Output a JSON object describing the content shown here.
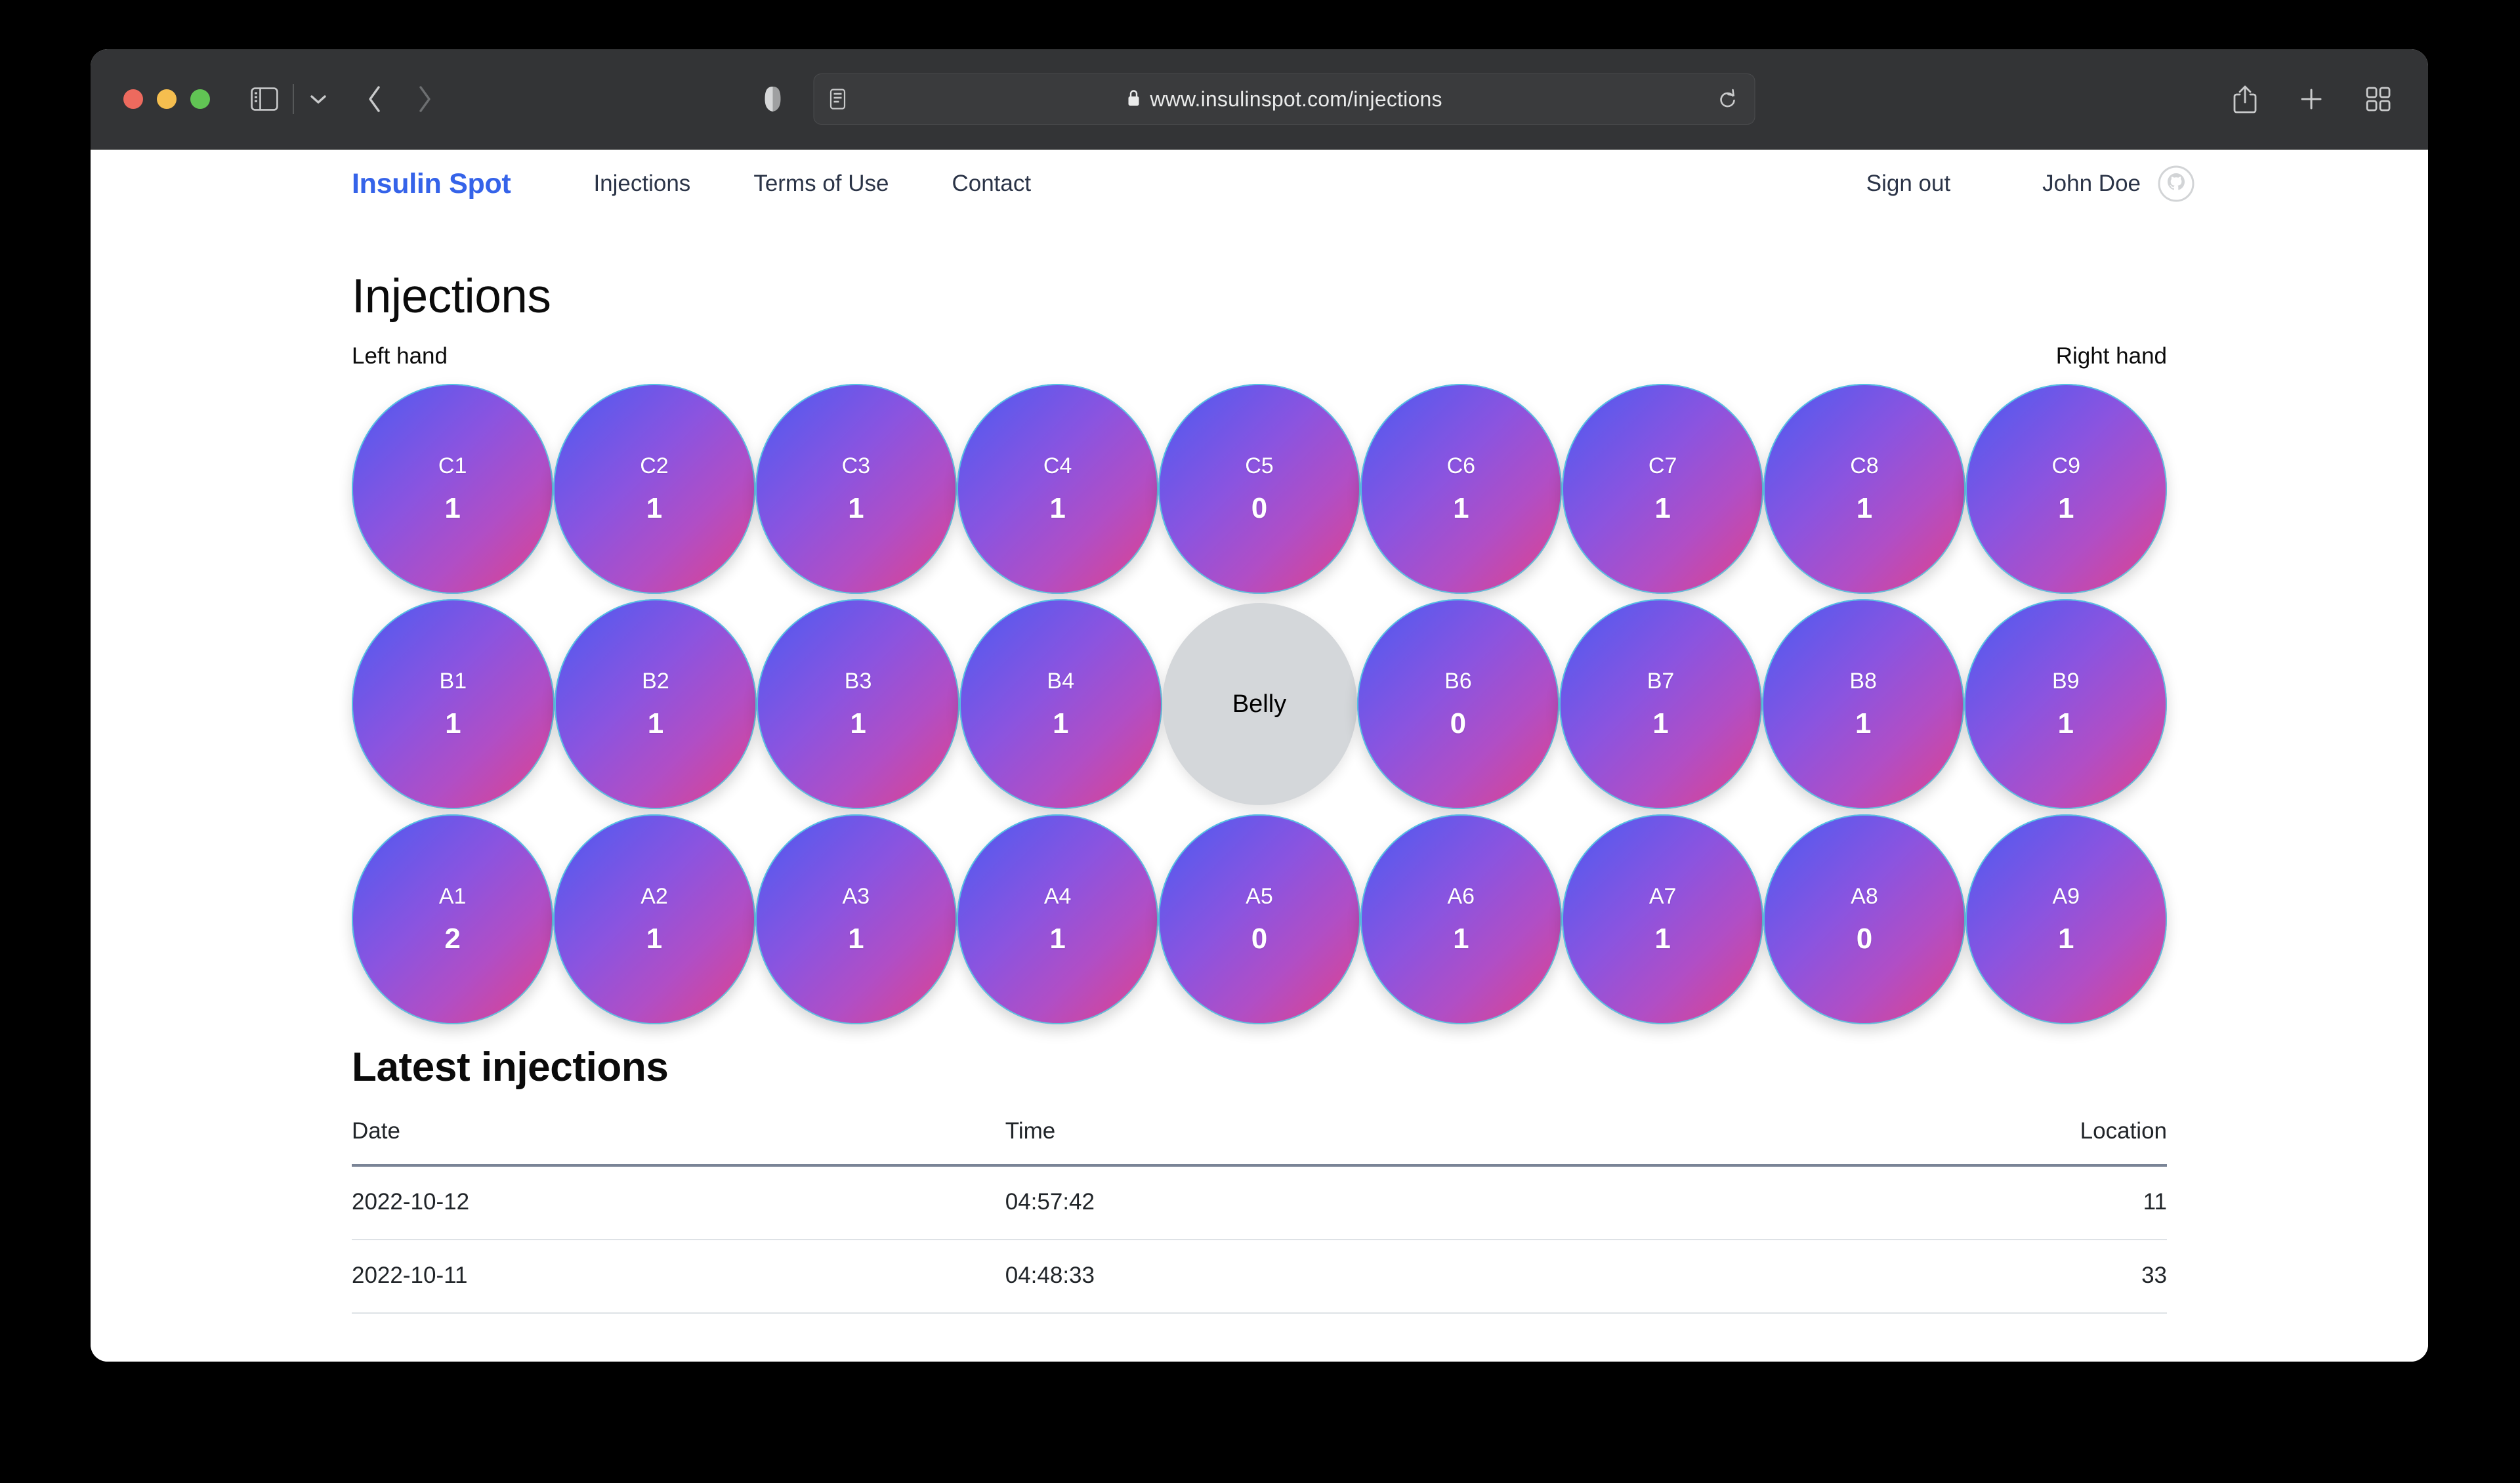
{
  "browser": {
    "url": "www.insulinspot.com/injections",
    "icons": {
      "sidebar": "sidebar-icon",
      "chevron_down": "chevron-down-icon",
      "back": "back-chevron-icon",
      "forward": "forward-chevron-icon",
      "shield": "privacy-shield-icon",
      "reader": "reader-view-icon",
      "lock": "lock-icon",
      "reload": "reload-icon",
      "share": "share-icon",
      "new_tab": "plus-icon",
      "tab_overview": "tab-overview-icon"
    }
  },
  "site": {
    "brand": "Insulin Spot",
    "nav_links": [
      "Injections",
      "Terms of Use",
      "Contact"
    ],
    "sign_out": "Sign out",
    "user_name": "John Doe",
    "avatar_icon": "github-octocat-icon"
  },
  "main": {
    "page_title": "Injections",
    "left_hand_label": "Left hand",
    "right_hand_label": "Right hand"
  },
  "grid": {
    "rows": [
      {
        "name": "C",
        "spots": [
          {
            "code": "C1",
            "count": "1"
          },
          {
            "code": "C2",
            "count": "1"
          },
          {
            "code": "C3",
            "count": "1"
          },
          {
            "code": "C4",
            "count": "1"
          },
          {
            "code": "C5",
            "count": "0"
          },
          {
            "code": "C6",
            "count": "1"
          },
          {
            "code": "C7",
            "count": "1"
          },
          {
            "code": "C8",
            "count": "1"
          },
          {
            "code": "C9",
            "count": "1"
          }
        ]
      },
      {
        "name": "B",
        "spots": [
          {
            "code": "B1",
            "count": "1"
          },
          {
            "code": "B2",
            "count": "1"
          },
          {
            "code": "B3",
            "count": "1"
          },
          {
            "code": "B4",
            "count": "1"
          },
          {
            "code": "Belly",
            "count": "",
            "type": "belly"
          },
          {
            "code": "B6",
            "count": "0"
          },
          {
            "code": "B7",
            "count": "1"
          },
          {
            "code": "B8",
            "count": "1"
          },
          {
            "code": "B9",
            "count": "1"
          }
        ]
      },
      {
        "name": "A",
        "spots": [
          {
            "code": "A1",
            "count": "2"
          },
          {
            "code": "A2",
            "count": "1"
          },
          {
            "code": "A3",
            "count": "1"
          },
          {
            "code": "A4",
            "count": "1"
          },
          {
            "code": "A5",
            "count": "0"
          },
          {
            "code": "A6",
            "count": "1"
          },
          {
            "code": "A7",
            "count": "1"
          },
          {
            "code": "A8",
            "count": "0"
          },
          {
            "code": "A9",
            "count": "1"
          }
        ]
      }
    ]
  },
  "latest": {
    "section_title": "Latest injections",
    "columns": [
      "Date",
      "Time",
      "Location"
    ],
    "rows": [
      {
        "date": "2022-10-12",
        "time": "04:57:42",
        "location": "11"
      },
      {
        "date": "2022-10-11",
        "time": "04:48:33",
        "location": "33"
      }
    ]
  },
  "colors": {
    "brand": "#3563E9",
    "gradient_start": "#4e4fe8",
    "gradient_end": "#dc4592",
    "belly": "#d4d7da"
  }
}
